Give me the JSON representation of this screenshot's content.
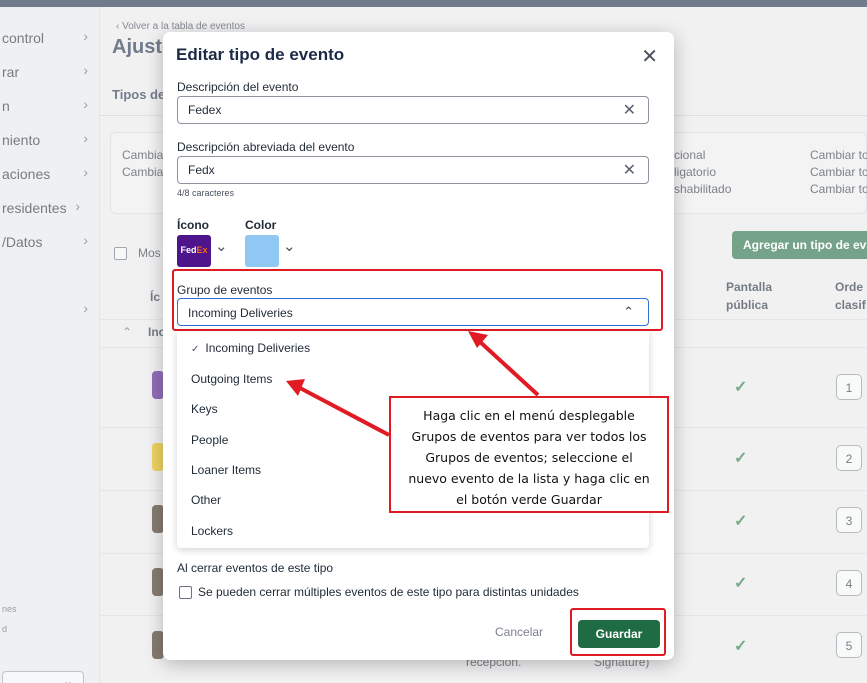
{
  "sidebar": {
    "items": [
      {
        "label": "control",
        "chevron": "›"
      },
      {
        "label": "rar",
        "chevron": "›"
      },
      {
        "label": "n",
        "chevron": "›"
      },
      {
        "label": "niento",
        "chevron": "›"
      },
      {
        "label": "aciones",
        "chevron": "›"
      },
      {
        "label": "residentes",
        "chevron": "›"
      },
      {
        "label": "/Datos",
        "chevron": "›"
      },
      {
        "label": "",
        "chevron": "›"
      }
    ],
    "small_1": "nes",
    "small_2": "d",
    "select_chevron": "⌄"
  },
  "background": {
    "back_link": "‹ Volver a la tabla de eventos",
    "page_title": "Ajuste",
    "tabs_label": "Tipos de",
    "card_left_1": "Cambia",
    "card_left_2": "Cambia",
    "card_mid_1": "cional",
    "card_mid_2": "ligatorio",
    "card_mid_3": "shabilitado",
    "card_right_1": "Cambiar to",
    "card_right_2": "Cambiar to",
    "card_right_3": "Cambiar to",
    "show_label": "Mos",
    "add_button": "Agregar un tipo de eve",
    "th_icon": "Íc",
    "th_public_1": "Pantalla",
    "th_public_2": "pública",
    "th_order_1": "Orde",
    "th_order_2": "clasif",
    "group_row": "Inc",
    "group_chevron": "⌃",
    "row_numbers": [
      "1",
      "2",
      "3",
      "4",
      "5"
    ],
    "check_mark": "✓",
    "bottom_text_1": "recepción.",
    "bottom_text_2": "Signature)"
  },
  "modal": {
    "title": "Editar tipo de evento",
    "close_symbol": "✕",
    "description_label": "Descripción del evento",
    "description_value": "Fedex",
    "short_description_label": "Descripción abreviada del evento",
    "short_description_value": "Fedx",
    "char_count": "4/8 caracteres",
    "clear_symbol": "✕",
    "icon_label": "Ícono",
    "icon_text_fe": "Fed",
    "icon_text_ex": "Ex",
    "color_label": "Color",
    "dropdown_chevron": "⌄",
    "group_label": "Grupo de eventos",
    "group_value": "Incoming Deliveries",
    "group_chevron_up": "⌃",
    "group_options": [
      {
        "label": "Incoming Deliveries",
        "selected": true
      },
      {
        "label": "Outgoing Items",
        "selected": false
      },
      {
        "label": "Keys",
        "selected": false
      },
      {
        "label": "People",
        "selected": false
      },
      {
        "label": "Loaner Items",
        "selected": false
      },
      {
        "label": "Other",
        "selected": false
      },
      {
        "label": "Lockers",
        "selected": false
      }
    ],
    "selected_tick": "✓",
    "close_section_label": "Al cerrar eventos de este tipo",
    "close_checkbox_label": "Se pueden cerrar múltiples eventos de este tipo para distintas unidades",
    "cancel_label": "Cancelar",
    "save_label": "Guardar"
  },
  "annotation": {
    "lines": [
      "Haga clic en el menú desplegable",
      "Grupos de eventos para ver todos los",
      "Grupos de eventos; seleccione el",
      "nuevo evento de la lista y haga clic en",
      "el botón verde Guardar"
    ]
  },
  "colors": {
    "accent_green": "#1f6b43",
    "highlight_red": "#e01b24",
    "fedex_purple": "#4d148c",
    "fedex_orange": "#ff6600",
    "selected_color": "#8fc8f3"
  }
}
